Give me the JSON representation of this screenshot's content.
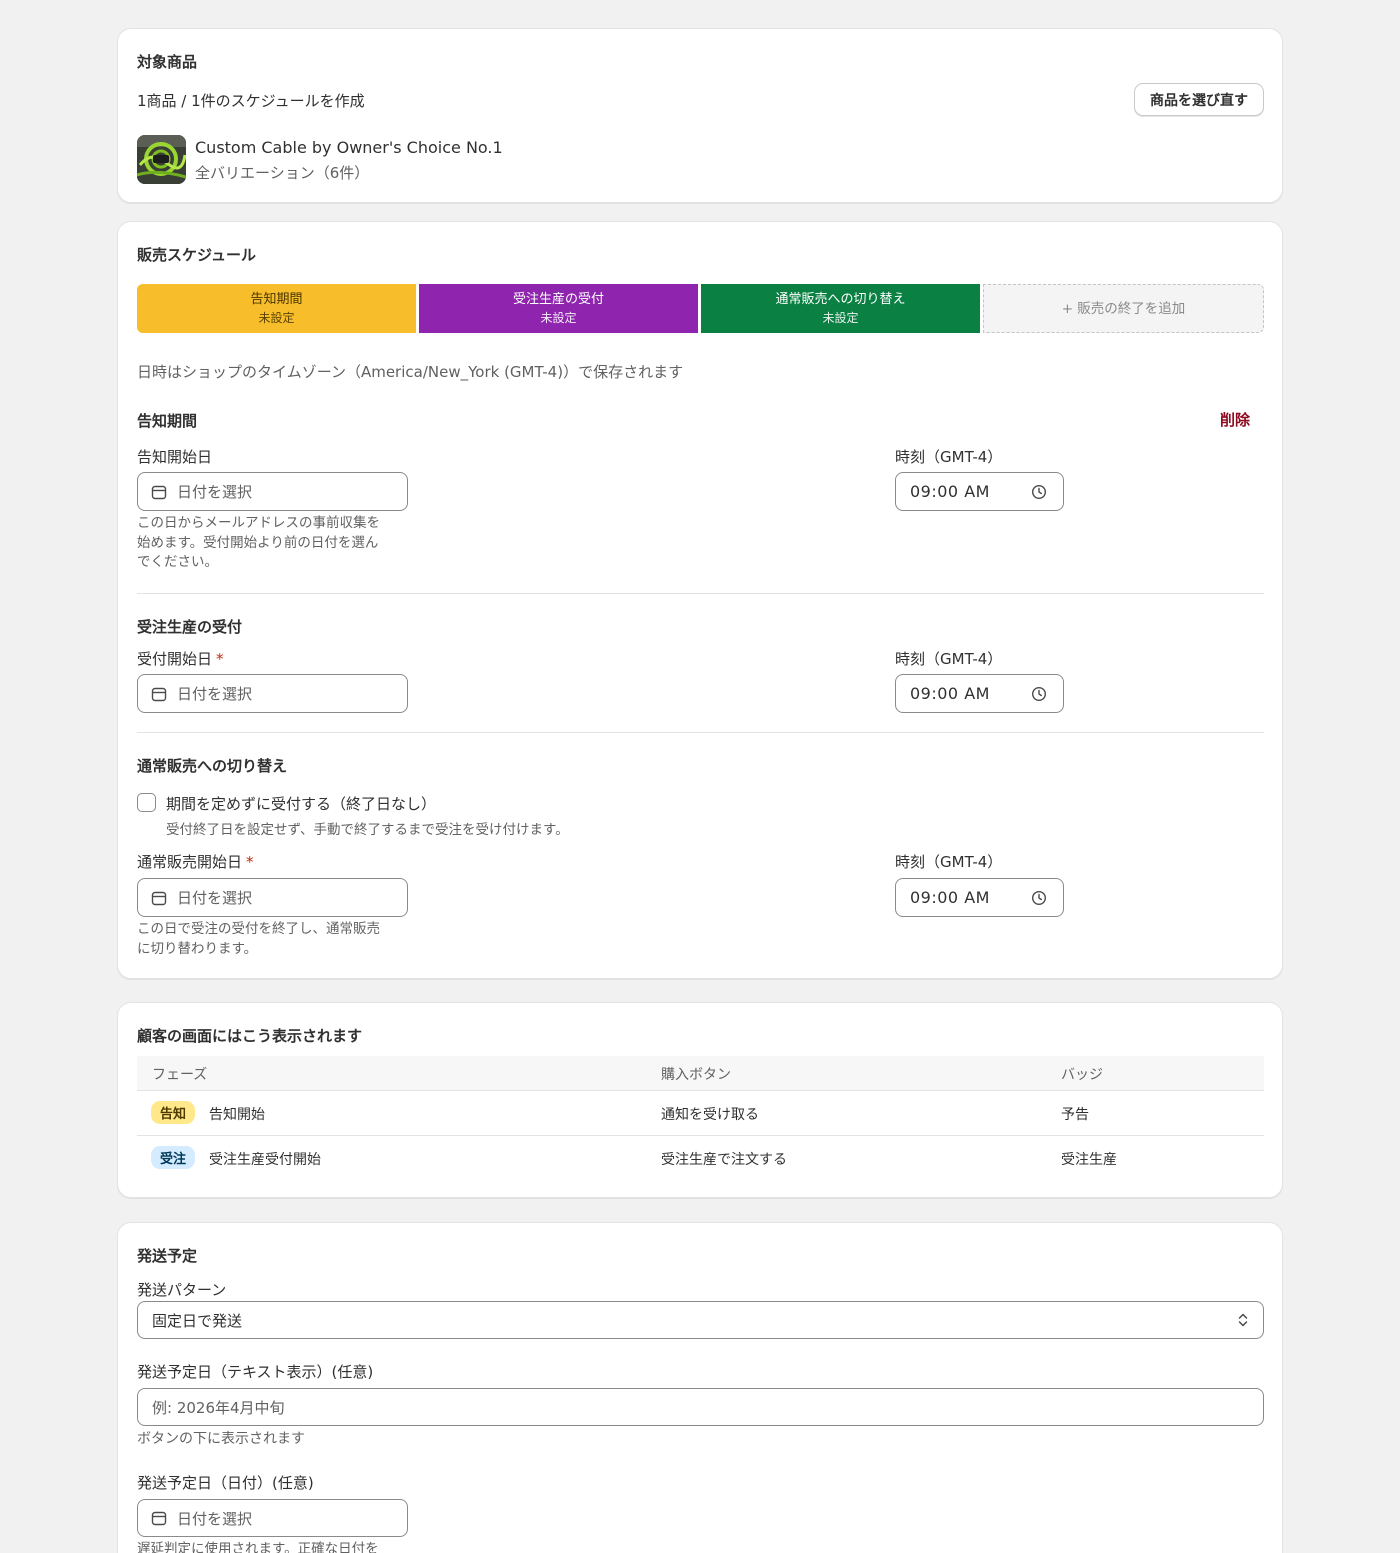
{
  "product_card": {
    "title": "対象商品",
    "summary": "1商品 / 1件のスケジュールを作成",
    "reselect_button": "商品を選び直す",
    "product_name": "Custom Cable by Owner's Choice No.1",
    "variations": "全バリエーション（6件）"
  },
  "schedule_card": {
    "title": "販売スケジュール",
    "phases": [
      {
        "label": "告知期間",
        "status": "未設定",
        "color": "#f7bd2a"
      },
      {
        "label": "受注生産の受付",
        "status": "未設定",
        "color": "#8f25ae"
      },
      {
        "label": "通常販売への切り替え",
        "status": "未設定",
        "color": "#0a8043"
      }
    ],
    "add_end_label": "+ 販売の終了を追加",
    "timezone_note": "日時はショップのタイムゾーン（America/New_York (GMT-4)）で保存されます",
    "announce": {
      "heading": "告知期間",
      "delete_label": "削除",
      "date_label": "告知開始日",
      "date_placeholder": "日付を選択",
      "help_lines": [
        "この日からメールアドレスの事前収集を",
        "始めます。受付開始より前の日付を選ん",
        "でください。"
      ],
      "time_label": "時刻（GMT-4）",
      "time_value": "09:00 AM"
    },
    "preorder": {
      "heading": "受注生産の受付",
      "date_label": "受付開始日",
      "required_mark": "*",
      "date_placeholder": "日付を選択",
      "time_label": "時刻（GMT-4）",
      "time_value": "09:00 AM"
    },
    "regular": {
      "heading": "通常販売への切り替え",
      "checkbox_label": "期間を定めずに受付する（終了日なし）",
      "checkbox_help": "受付終了日を設定せず、手動で終了するまで受注を受け付けます。",
      "date_label": "通常販売開始日",
      "required_mark": "*",
      "date_placeholder": "日付を選択",
      "help_lines": [
        "この日で受注の受付を終了し、通常販売",
        "に切り替わります。"
      ],
      "time_label": "時刻（GMT-4）",
      "time_value": "09:00 AM"
    }
  },
  "preview_card": {
    "title": "顧客の画面にはこう表示されます",
    "columns": [
      "フェーズ",
      "購入ボタン",
      "バッジ"
    ],
    "rows": [
      {
        "tag": "告知",
        "tag_bg": "#ffe88a",
        "tag_color": "#4f3a00",
        "phase": "告知開始",
        "button": "通知を受け取る",
        "badge": "予告"
      },
      {
        "tag": "受注",
        "tag_bg": "#d5ebff",
        "tag_color": "#003a5a",
        "phase": "受注生産受付開始",
        "button": "受注生産で注文する",
        "badge": "受注生産"
      }
    ]
  },
  "shipping_card": {
    "title": "発送予定",
    "pattern_label": "発送パターン",
    "pattern_value": "固定日で発送",
    "text_date_label": "発送予定日（テキスト表示）(任意)",
    "text_date_placeholder": "例: 2026年4月中旬",
    "text_date_help": "ボタンの下に表示されます",
    "date_label": "発送予定日（日付）(任意)",
    "date_placeholder": "日付を選択",
    "date_help": "遅延判定に使用されます。正確な日付を"
  }
}
